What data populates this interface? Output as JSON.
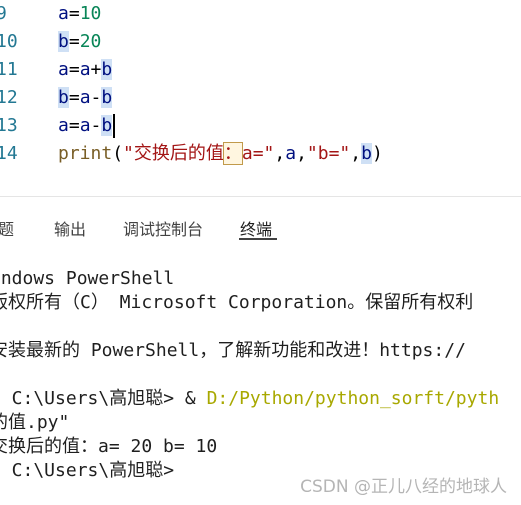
{
  "editor": {
    "lines": [
      {
        "num": "9",
        "parts": [
          "a",
          "=",
          "10"
        ]
      },
      {
        "num": "10",
        "parts": [
          "b",
          "=",
          "20"
        ]
      },
      {
        "num": "11",
        "parts": [
          "a",
          "=",
          "a",
          "+",
          "b"
        ]
      },
      {
        "num": "12",
        "parts": [
          "b",
          "=",
          "a",
          "-",
          "b"
        ]
      },
      {
        "num": "13",
        "parts": [
          "a",
          "=",
          "a",
          "-",
          "b"
        ]
      },
      {
        "num": "14",
        "parts": [
          "print",
          "(",
          "\"交换后的值",
          "：",
          "a=\"",
          ",",
          "a",
          ",",
          "\"b=\"",
          ",",
          "b",
          ")"
        ]
      }
    ]
  },
  "panel": {
    "tabs": [
      {
        "label": "题"
      },
      {
        "label": "输出"
      },
      {
        "label": "调试控制台"
      },
      {
        "label": "终端"
      }
    ]
  },
  "terminal": {
    "l1": "indows PowerShell",
    "l2": "版权所有（C） Microsoft Corporation。保留所有权利",
    "l3": "安装最新的 PowerShell，了解新功能和改进！https://",
    "l4_prompt": "S C:\\Users\\高旭聪> & ",
    "l4_path": "D:/Python/python_sorft/pyth",
    "l5": "的值.py\"",
    "l6": "交换后的值：a= 20 b= 10",
    "l7": "S C:\\Users\\高旭聪>"
  },
  "watermark": "CSDN @正儿八经的地球人"
}
